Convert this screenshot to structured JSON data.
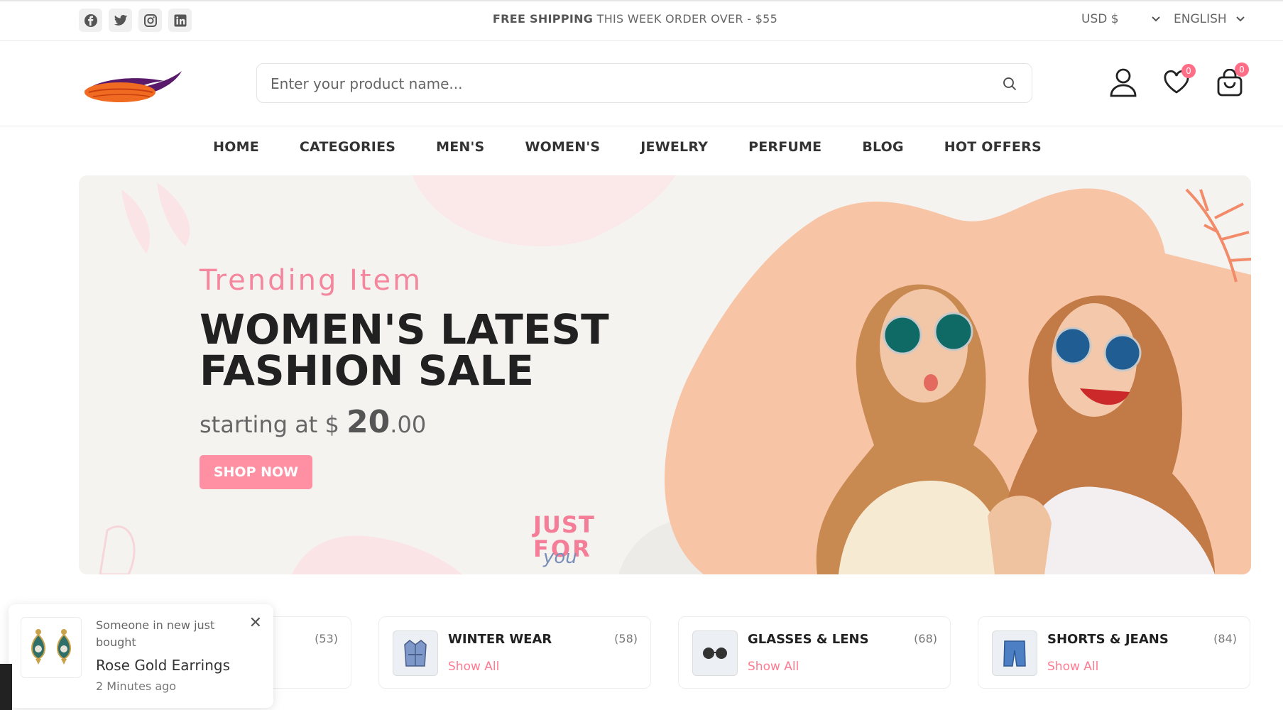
{
  "topbar": {
    "social": [
      {
        "icon": "facebook-icon"
      },
      {
        "icon": "twitter-icon"
      },
      {
        "icon": "instagram-icon"
      },
      {
        "icon": "linkedin-icon"
      }
    ],
    "shipping_bold": "FREE SHIPPING",
    "shipping_rest": " THIS WEEK ORDER OVER - $55",
    "currency": "USD $",
    "language": "ENGLISH"
  },
  "header": {
    "search_placeholder": "Enter your product name...",
    "wishlist_count": "0",
    "cart_count": "0"
  },
  "nav": [
    "HOME",
    "CATEGORIES",
    "MEN'S",
    "WOMEN'S",
    "JEWELRY",
    "PERFUME",
    "BLOG",
    "HOT OFFERS"
  ],
  "hero": {
    "subtitle": "Trending Item",
    "title": "WOMEN'S LATEST FASHION SALE",
    "start_text": "starting at $ ",
    "price_main": "20",
    "price_cents": ".00",
    "button": "SHOP NOW",
    "stamp_line1": "JUST",
    "stamp_line2": "FOR",
    "stamp_line3": "you"
  },
  "categories": [
    {
      "title": "",
      "count": "(53)",
      "link": ""
    },
    {
      "title": "WINTER WEAR",
      "count": "(58)",
      "link": "Show All"
    },
    {
      "title": "GLASSES & LENS",
      "count": "(68)",
      "link": "Show All"
    },
    {
      "title": "SHORTS & JEANS",
      "count": "(84)",
      "link": "Show All"
    }
  ],
  "toast": {
    "line1": "Someone in new just bought",
    "product": "Rose Gold Earrings",
    "time": "2 Minutes ago",
    "close": "✕"
  },
  "colors": {
    "accent": "#ff8fa3",
    "badge": "#ff6d86",
    "hero_bg": "#f5f3f0",
    "peach": "#f7c4a6"
  }
}
